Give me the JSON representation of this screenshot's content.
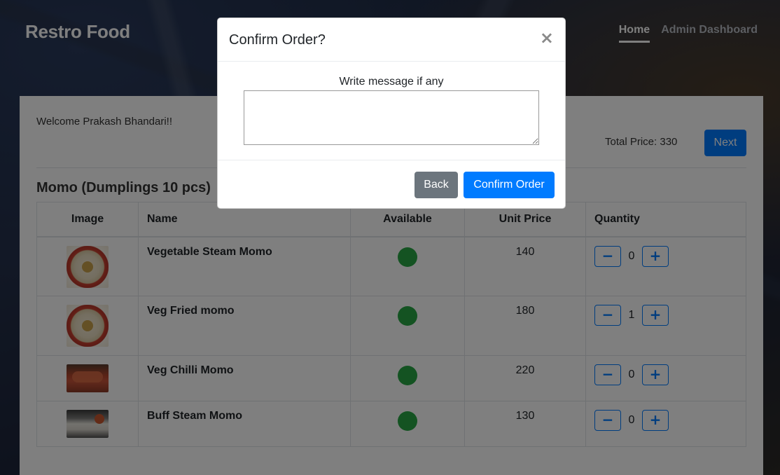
{
  "navbar": {
    "brand": "Restro Food",
    "links": [
      {
        "label": "Home",
        "active": true
      },
      {
        "label": "Admin Dashboard",
        "active": false
      }
    ]
  },
  "main": {
    "welcome": "Welcome Prakash Bhandari!!",
    "total_price": "Total Price: 330",
    "next_label": "Next",
    "category_title": "Momo (Dumplings 10 pcs)",
    "table": {
      "headers": [
        "Image",
        "Name",
        "Available",
        "Unit Price",
        "Quantity"
      ],
      "rows": [
        {
          "name": "Vegetable Steam Momo",
          "available": true,
          "price": "140",
          "qty": "0"
        },
        {
          "name": "Veg Fried momo",
          "available": true,
          "price": "180",
          "qty": "1"
        },
        {
          "name": "Veg Chilli Momo",
          "available": true,
          "price": "220",
          "qty": "0"
        },
        {
          "name": "Buff Steam Momo",
          "available": true,
          "price": "130",
          "qty": "0"
        }
      ],
      "minus_glyph": "−",
      "plus_glyph": "+"
    }
  },
  "modal": {
    "title": "Confirm Order?",
    "close_glyph": "×",
    "message_label": "Write message if any",
    "message_value": "",
    "back_label": "Back",
    "confirm_label": "Confirm Order"
  },
  "colors": {
    "primary": "#007bff",
    "secondary": "#6c757d",
    "available": "#28a745"
  }
}
